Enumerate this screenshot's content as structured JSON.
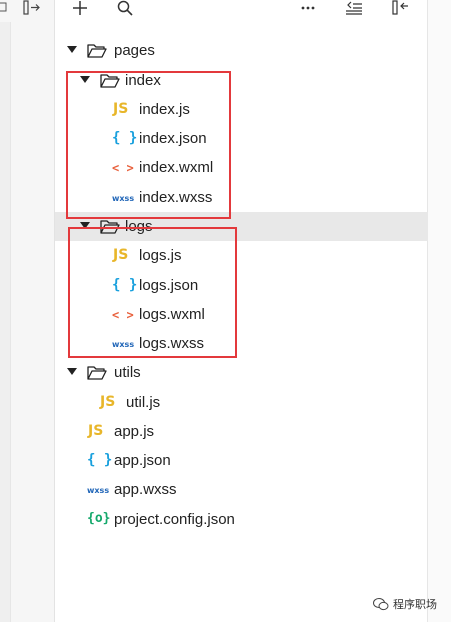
{
  "toolbar": {
    "add_icon": "plus-icon",
    "search_icon": "search-icon",
    "more_icon": "more-horizontal-icon",
    "collapse_icon": "collapse-all-icon",
    "toggle_panel_icon": "panel-collapse-icon"
  },
  "tree": [
    {
      "name": "pages",
      "type": "folder",
      "expanded": true
    },
    {
      "name": "index",
      "type": "folder",
      "expanded": true
    },
    {
      "name": "index.js",
      "type": "js",
      "badge": "JS"
    },
    {
      "name": "index.json",
      "type": "json",
      "badge": "{ }"
    },
    {
      "name": "index.wxml",
      "type": "wxml",
      "badge": "< >"
    },
    {
      "name": "index.wxss",
      "type": "wxss",
      "badge": "wxss"
    },
    {
      "name": "logs",
      "type": "folder",
      "expanded": true,
      "selected": true
    },
    {
      "name": "logs.js",
      "type": "js",
      "badge": "JS"
    },
    {
      "name": "logs.json",
      "type": "json",
      "badge": "{ }"
    },
    {
      "name": "logs.wxml",
      "type": "wxml",
      "badge": "< >"
    },
    {
      "name": "logs.wxss",
      "type": "wxss",
      "badge": "wxss"
    },
    {
      "name": "utils",
      "type": "folder",
      "expanded": true
    },
    {
      "name": "util.js",
      "type": "js",
      "badge": "JS"
    },
    {
      "name": "app.js",
      "type": "js",
      "badge": "JS"
    },
    {
      "name": "app.json",
      "type": "json",
      "badge": "{ }"
    },
    {
      "name": "app.wxss",
      "type": "wxss",
      "badge": "wxss"
    },
    {
      "name": "project.config.json",
      "type": "config",
      "badge": "{o}"
    }
  ],
  "highlight_color": "#e3393c",
  "watermark": {
    "text": "程序职场"
  }
}
